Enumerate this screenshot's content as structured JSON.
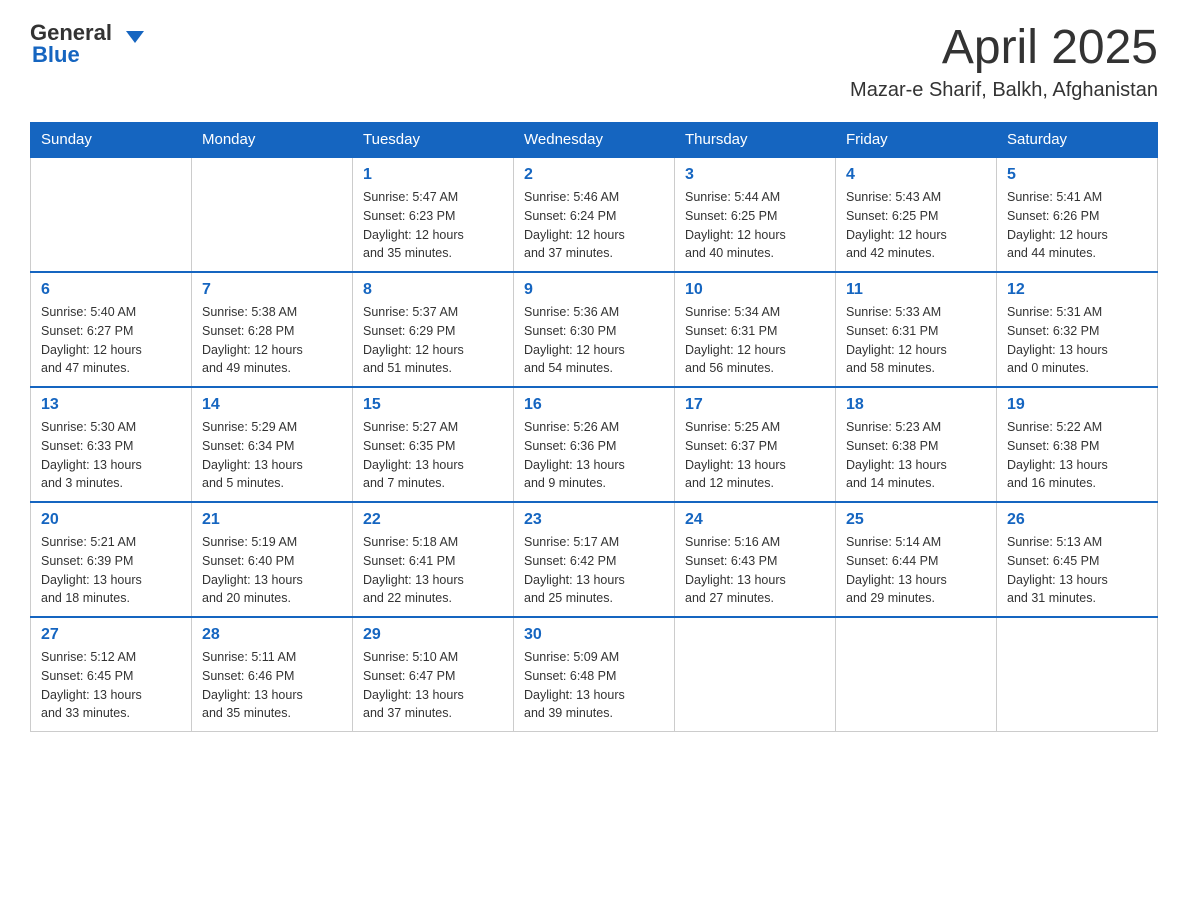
{
  "logo": {
    "text_general": "General",
    "text_blue": "Blue"
  },
  "title": "April 2025",
  "subtitle": "Mazar-e Sharif, Balkh, Afghanistan",
  "days_of_week": [
    "Sunday",
    "Monday",
    "Tuesday",
    "Wednesday",
    "Thursday",
    "Friday",
    "Saturday"
  ],
  "weeks": [
    [
      {
        "day": "",
        "info": ""
      },
      {
        "day": "",
        "info": ""
      },
      {
        "day": "1",
        "info": "Sunrise: 5:47 AM\nSunset: 6:23 PM\nDaylight: 12 hours\nand 35 minutes."
      },
      {
        "day": "2",
        "info": "Sunrise: 5:46 AM\nSunset: 6:24 PM\nDaylight: 12 hours\nand 37 minutes."
      },
      {
        "day": "3",
        "info": "Sunrise: 5:44 AM\nSunset: 6:25 PM\nDaylight: 12 hours\nand 40 minutes."
      },
      {
        "day": "4",
        "info": "Sunrise: 5:43 AM\nSunset: 6:25 PM\nDaylight: 12 hours\nand 42 minutes."
      },
      {
        "day": "5",
        "info": "Sunrise: 5:41 AM\nSunset: 6:26 PM\nDaylight: 12 hours\nand 44 minutes."
      }
    ],
    [
      {
        "day": "6",
        "info": "Sunrise: 5:40 AM\nSunset: 6:27 PM\nDaylight: 12 hours\nand 47 minutes."
      },
      {
        "day": "7",
        "info": "Sunrise: 5:38 AM\nSunset: 6:28 PM\nDaylight: 12 hours\nand 49 minutes."
      },
      {
        "day": "8",
        "info": "Sunrise: 5:37 AM\nSunset: 6:29 PM\nDaylight: 12 hours\nand 51 minutes."
      },
      {
        "day": "9",
        "info": "Sunrise: 5:36 AM\nSunset: 6:30 PM\nDaylight: 12 hours\nand 54 minutes."
      },
      {
        "day": "10",
        "info": "Sunrise: 5:34 AM\nSunset: 6:31 PM\nDaylight: 12 hours\nand 56 minutes."
      },
      {
        "day": "11",
        "info": "Sunrise: 5:33 AM\nSunset: 6:31 PM\nDaylight: 12 hours\nand 58 minutes."
      },
      {
        "day": "12",
        "info": "Sunrise: 5:31 AM\nSunset: 6:32 PM\nDaylight: 13 hours\nand 0 minutes."
      }
    ],
    [
      {
        "day": "13",
        "info": "Sunrise: 5:30 AM\nSunset: 6:33 PM\nDaylight: 13 hours\nand 3 minutes."
      },
      {
        "day": "14",
        "info": "Sunrise: 5:29 AM\nSunset: 6:34 PM\nDaylight: 13 hours\nand 5 minutes."
      },
      {
        "day": "15",
        "info": "Sunrise: 5:27 AM\nSunset: 6:35 PM\nDaylight: 13 hours\nand 7 minutes."
      },
      {
        "day": "16",
        "info": "Sunrise: 5:26 AM\nSunset: 6:36 PM\nDaylight: 13 hours\nand 9 minutes."
      },
      {
        "day": "17",
        "info": "Sunrise: 5:25 AM\nSunset: 6:37 PM\nDaylight: 13 hours\nand 12 minutes."
      },
      {
        "day": "18",
        "info": "Sunrise: 5:23 AM\nSunset: 6:38 PM\nDaylight: 13 hours\nand 14 minutes."
      },
      {
        "day": "19",
        "info": "Sunrise: 5:22 AM\nSunset: 6:38 PM\nDaylight: 13 hours\nand 16 minutes."
      }
    ],
    [
      {
        "day": "20",
        "info": "Sunrise: 5:21 AM\nSunset: 6:39 PM\nDaylight: 13 hours\nand 18 minutes."
      },
      {
        "day": "21",
        "info": "Sunrise: 5:19 AM\nSunset: 6:40 PM\nDaylight: 13 hours\nand 20 minutes."
      },
      {
        "day": "22",
        "info": "Sunrise: 5:18 AM\nSunset: 6:41 PM\nDaylight: 13 hours\nand 22 minutes."
      },
      {
        "day": "23",
        "info": "Sunrise: 5:17 AM\nSunset: 6:42 PM\nDaylight: 13 hours\nand 25 minutes."
      },
      {
        "day": "24",
        "info": "Sunrise: 5:16 AM\nSunset: 6:43 PM\nDaylight: 13 hours\nand 27 minutes."
      },
      {
        "day": "25",
        "info": "Sunrise: 5:14 AM\nSunset: 6:44 PM\nDaylight: 13 hours\nand 29 minutes."
      },
      {
        "day": "26",
        "info": "Sunrise: 5:13 AM\nSunset: 6:45 PM\nDaylight: 13 hours\nand 31 minutes."
      }
    ],
    [
      {
        "day": "27",
        "info": "Sunrise: 5:12 AM\nSunset: 6:45 PM\nDaylight: 13 hours\nand 33 minutes."
      },
      {
        "day": "28",
        "info": "Sunrise: 5:11 AM\nSunset: 6:46 PM\nDaylight: 13 hours\nand 35 minutes."
      },
      {
        "day": "29",
        "info": "Sunrise: 5:10 AM\nSunset: 6:47 PM\nDaylight: 13 hours\nand 37 minutes."
      },
      {
        "day": "30",
        "info": "Sunrise: 5:09 AM\nSunset: 6:48 PM\nDaylight: 13 hours\nand 39 minutes."
      },
      {
        "day": "",
        "info": ""
      },
      {
        "day": "",
        "info": ""
      },
      {
        "day": "",
        "info": ""
      }
    ]
  ]
}
